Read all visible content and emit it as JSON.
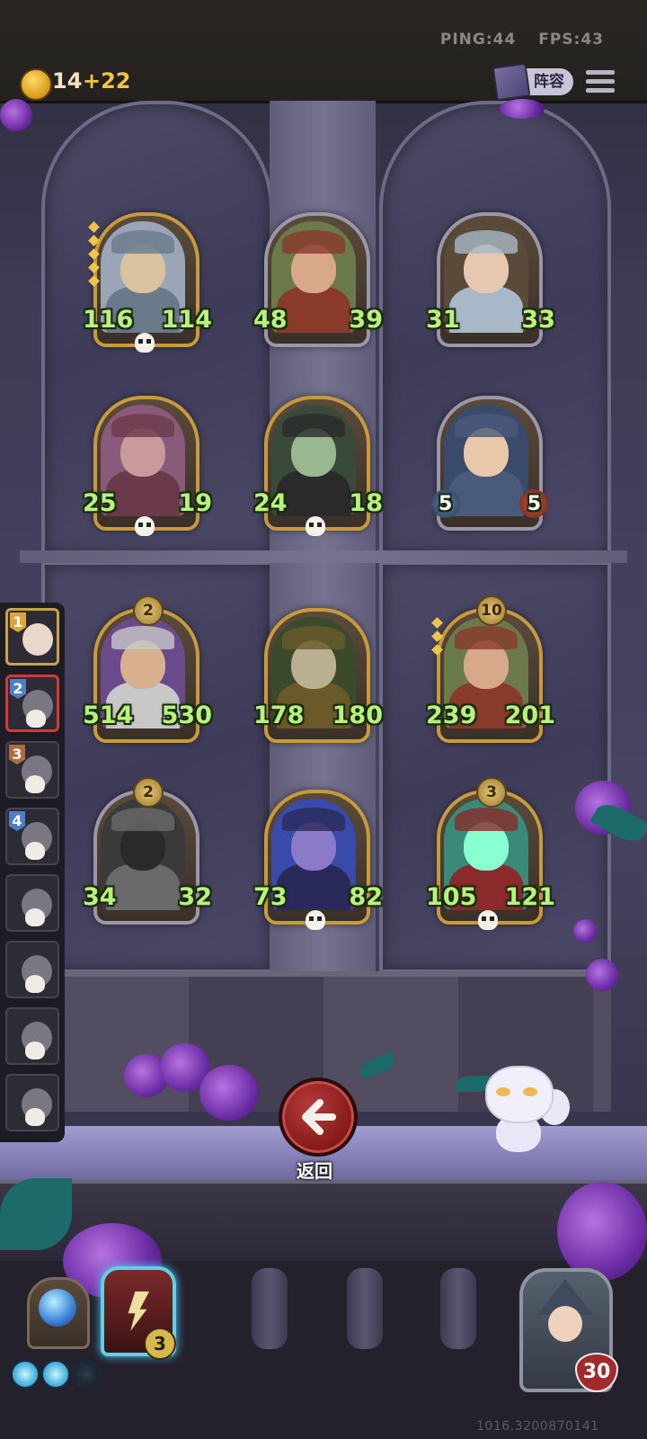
{
  "status": {
    "ping": "PING:44",
    "fps": "FPS:43"
  },
  "resources": {
    "gold": "14",
    "gold_income": "+22"
  },
  "topbar": {
    "lineup_label": "阵容"
  },
  "board": {
    "rows": [
      [
        {
          "atk": "116",
          "hp": "114",
          "skull": true,
          "level": "",
          "frame": "gold"
        },
        {
          "atk": "48",
          "hp": "39",
          "skull": false,
          "level": "",
          "frame": "silver"
        },
        {
          "atk": "31",
          "hp": "33",
          "skull": false,
          "level": "",
          "frame": "silver"
        }
      ],
      [
        {
          "atk": "25",
          "hp": "19",
          "skull": true,
          "level": "",
          "frame": "gold"
        },
        {
          "atk": "24",
          "hp": "18",
          "skull": true,
          "level": "",
          "frame": "gold"
        },
        {
          "atk": "5",
          "hp": "5",
          "skull": false,
          "level": "",
          "frame": "silver"
        }
      ],
      [
        {
          "atk": "514",
          "hp": "530",
          "skull": false,
          "level": "2",
          "frame": "gold"
        },
        {
          "atk": "178",
          "hp": "180",
          "skull": false,
          "level": "",
          "frame": "gold"
        },
        {
          "atk": "239",
          "hp": "201",
          "skull": false,
          "level": "10",
          "frame": "gold"
        }
      ],
      [
        {
          "atk": "34",
          "hp": "32",
          "skull": false,
          "level": "2",
          "frame": "silver"
        },
        {
          "atk": "73",
          "hp": "82",
          "skull": true,
          "level": "",
          "frame": "gold"
        },
        {
          "atk": "105",
          "hp": "121",
          "skull": true,
          "level": "3",
          "frame": "gold"
        }
      ]
    ]
  },
  "opponents": [
    {
      "rank": "1",
      "state": "active"
    },
    {
      "rank": "2",
      "state": "selected"
    },
    {
      "rank": "3",
      "state": "dead"
    },
    {
      "rank": "4",
      "state": "dead"
    },
    {
      "rank": "",
      "state": "dead"
    },
    {
      "rank": "",
      "state": "dead"
    },
    {
      "rank": "",
      "state": "dead"
    },
    {
      "rank": "",
      "state": "dead"
    }
  ],
  "actions": {
    "back_label": "返回"
  },
  "hand": {
    "spell_count": "3"
  },
  "player": {
    "health": "30"
  },
  "footer": {
    "coords": "1016.3200870141"
  },
  "colors": {
    "stat_green": "#b8f27a",
    "gold_border": "#c99a3a",
    "back_red": "#b83a3a"
  }
}
